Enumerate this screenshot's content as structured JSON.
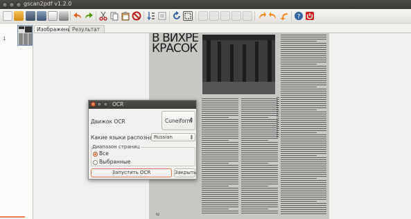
{
  "window": {
    "title": "gscan2pdf v1.2.0"
  },
  "toolbar": {
    "icons": [
      "new-icon",
      "open-icon",
      "scan-icon",
      "save-icon",
      "email-icon",
      "print-icon",
      "undo-icon",
      "redo-icon",
      "cut-icon",
      "copy-icon",
      "paste-icon",
      "delete-icon",
      "renumber-icon",
      "select-all-icon",
      "rotate-icon",
      "crop-icon",
      "zoom-icon",
      "rotate-left-icon",
      "rotate-right-icon",
      "help-icon",
      "quit-icon"
    ]
  },
  "thumbnails": {
    "items": [
      {
        "index": "1"
      }
    ]
  },
  "tabs": [
    {
      "label": "Изображение",
      "active": true
    },
    {
      "label": "Результат OCR",
      "active": false
    }
  ],
  "page_image": {
    "heading_line1": "В ВИХРЕ",
    "heading_line2": "КРАСОК",
    "page_number": "92"
  },
  "dialog": {
    "title": "OCR",
    "engine_label": "Движок OCR",
    "engine_value": "Cuneiform",
    "language_label": "Какие языки распознавать",
    "language_value": "Russian",
    "range_label": "Диапазон страниц",
    "range_all": "Все",
    "range_selected": "Выбранные",
    "run_button": "Запустить OCR",
    "close_button": "Закрыть"
  },
  "colors": {
    "accent": "#e15c23",
    "titlebar": "#3c3b37"
  }
}
